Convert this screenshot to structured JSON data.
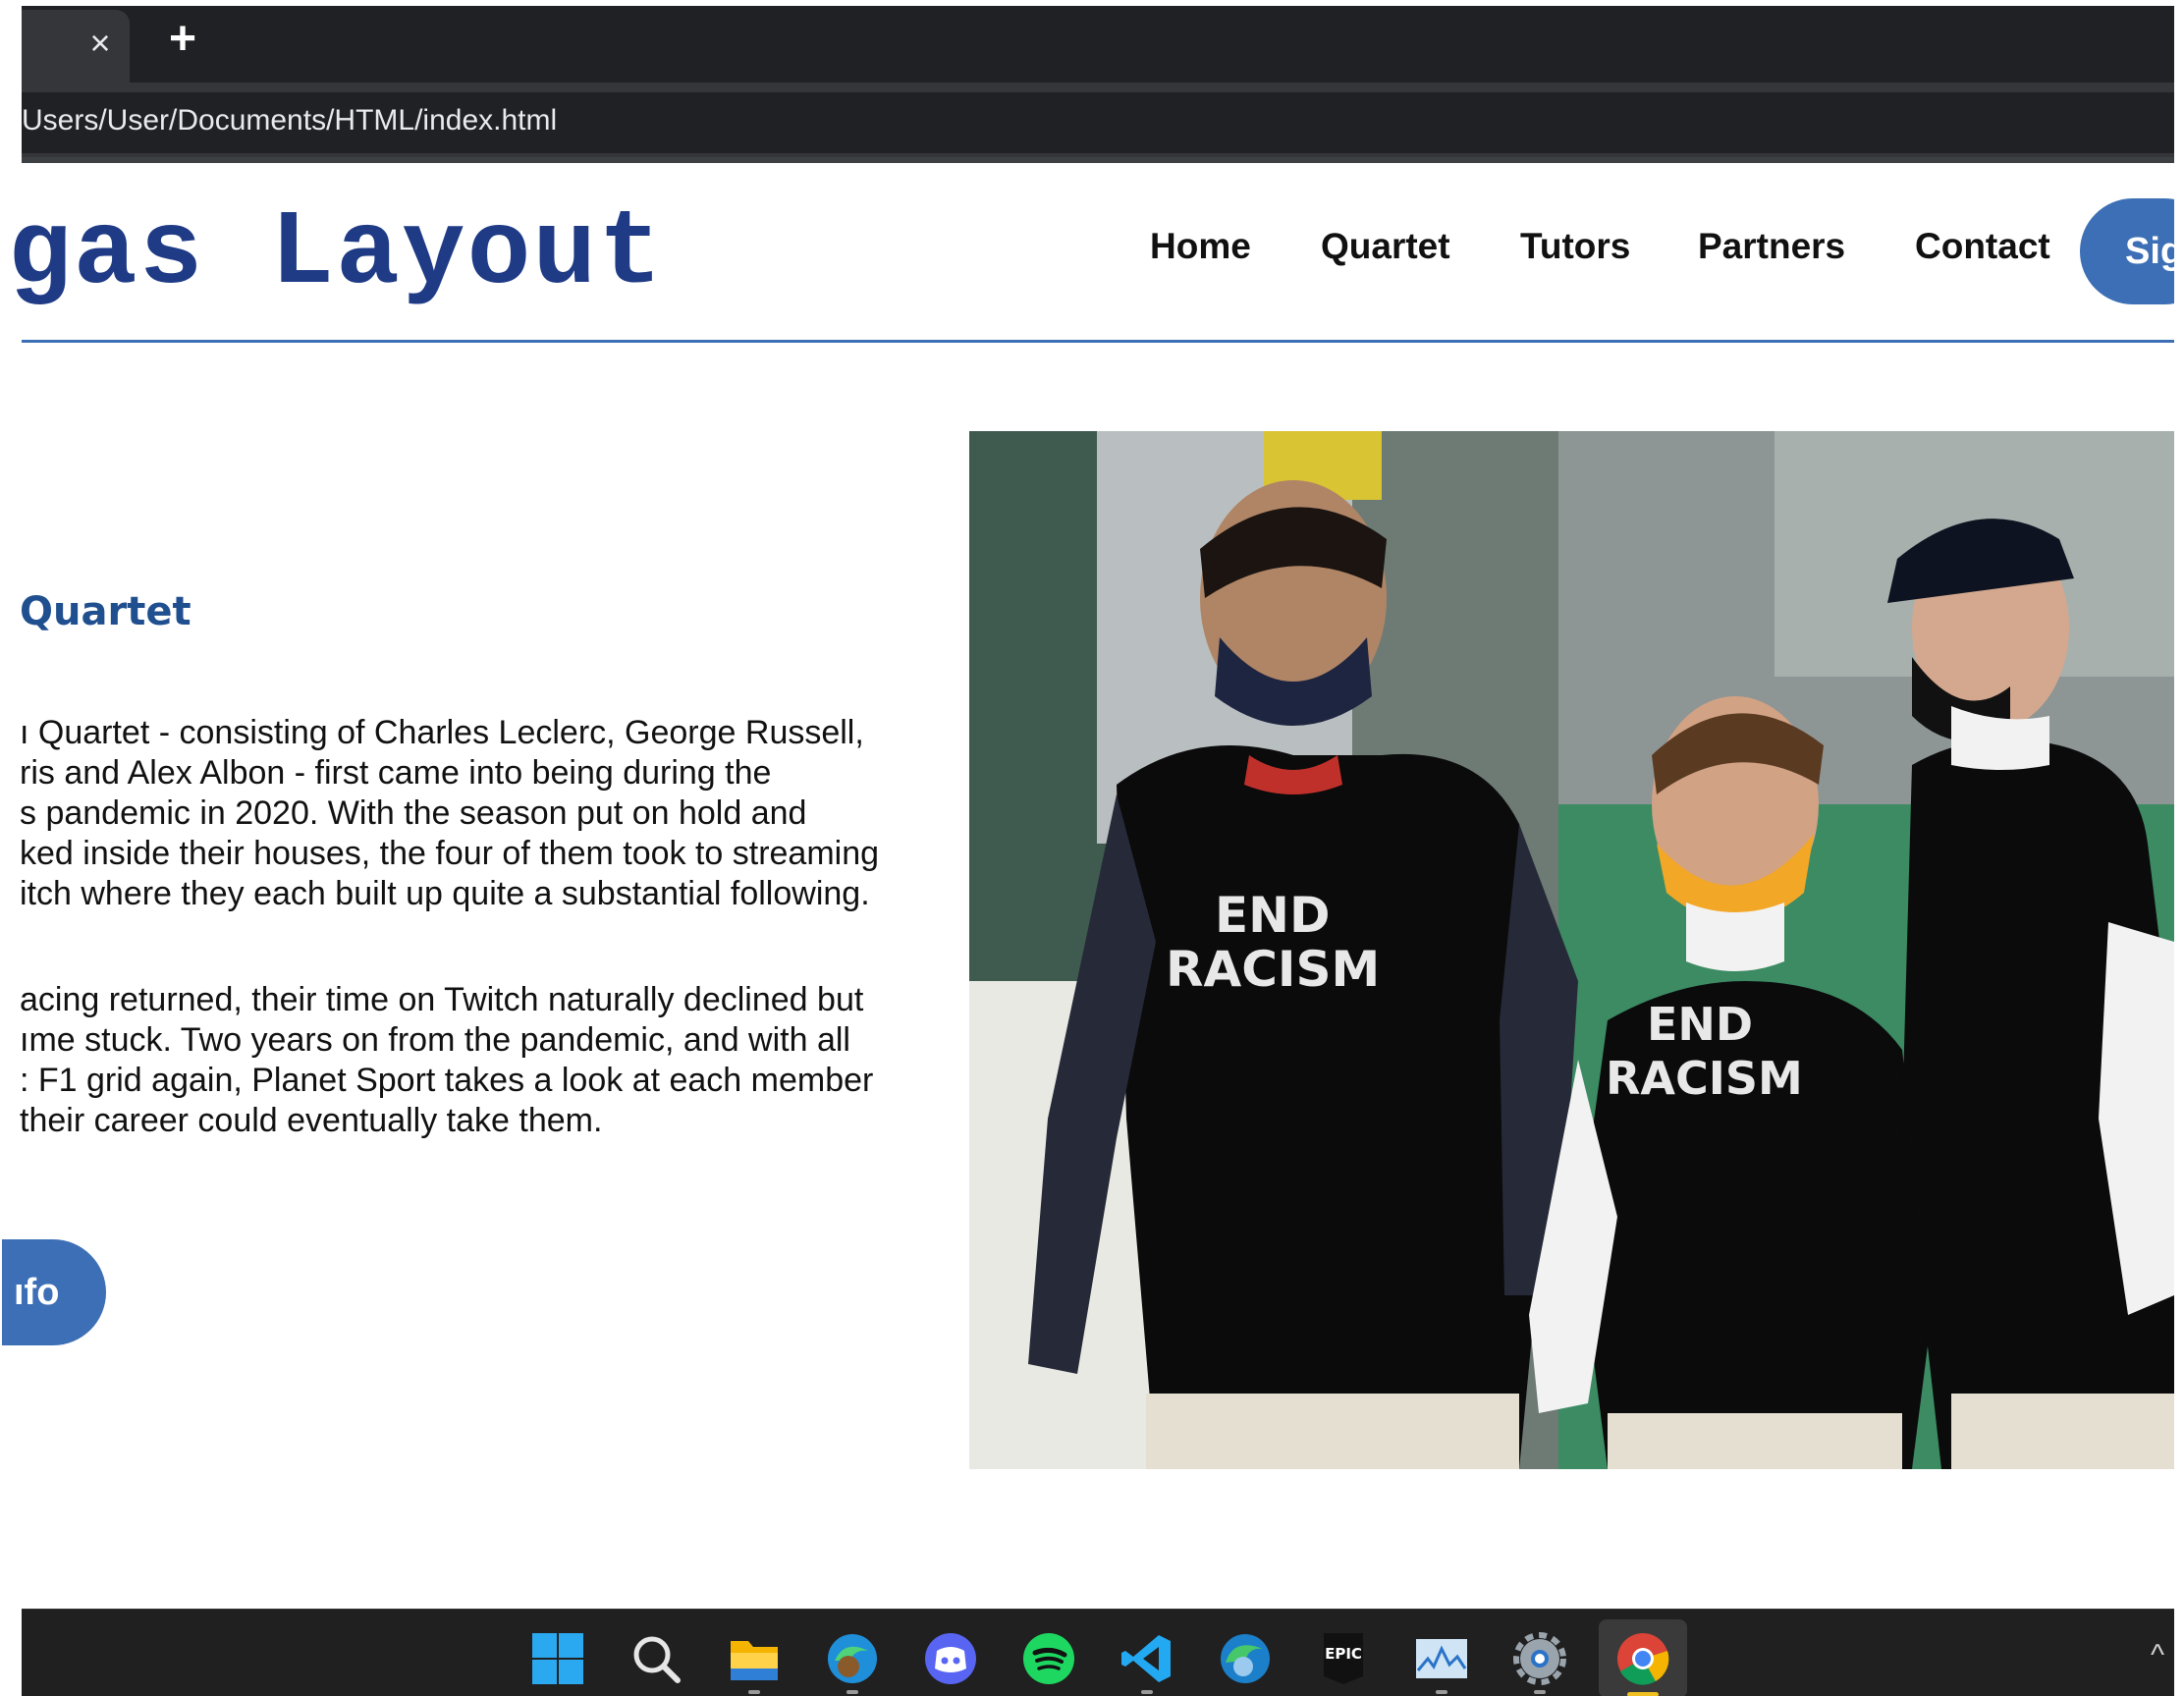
{
  "browser": {
    "tab_close_glyph": "×",
    "new_tab_glyph": "+",
    "url": "Users/User/Documents/HTML/index.html"
  },
  "header": {
    "site_title": "gas Layout",
    "nav": [
      "Home",
      "Quartet",
      "Tutors",
      "Partners",
      "Contact"
    ],
    "signup_label": "Sig",
    "accent_color": "#3c6fb5",
    "title_color": "#1f3b86"
  },
  "main": {
    "heading": "Quartet",
    "paragraph1": [
      "ı Quartet - consisting of Charles Leclerc, George Russell,",
      "ris and Alex Albon - first came into being during the",
      "s pandemic in 2020. With the season put on hold and",
      "ked inside their houses, the four of them took to streaming",
      "itch where they each built up quite a substantial following."
    ],
    "paragraph2": [
      "acing returned, their time on Twitch naturally declined but",
      "ıme stuck. Two years on from the pandemic, and with all",
      ": F1 grid again, Planet Sport takes a look at each member",
      " their career could eventually take them."
    ],
    "info_button_label": "ıfo",
    "hero_shirt_text": [
      "END",
      "RACISM"
    ]
  },
  "taskbar": {
    "icons": [
      "windows-start-icon",
      "search-icon",
      "file-explorer-icon",
      "edge-beta-icon",
      "discord-icon",
      "spotify-icon",
      "vscode-icon",
      "edge-icon",
      "epic-games-icon",
      "performance-monitor-icon",
      "settings-icon",
      "chrome-icon"
    ],
    "epic_label": "EPIC",
    "tray_chevron": "^"
  }
}
